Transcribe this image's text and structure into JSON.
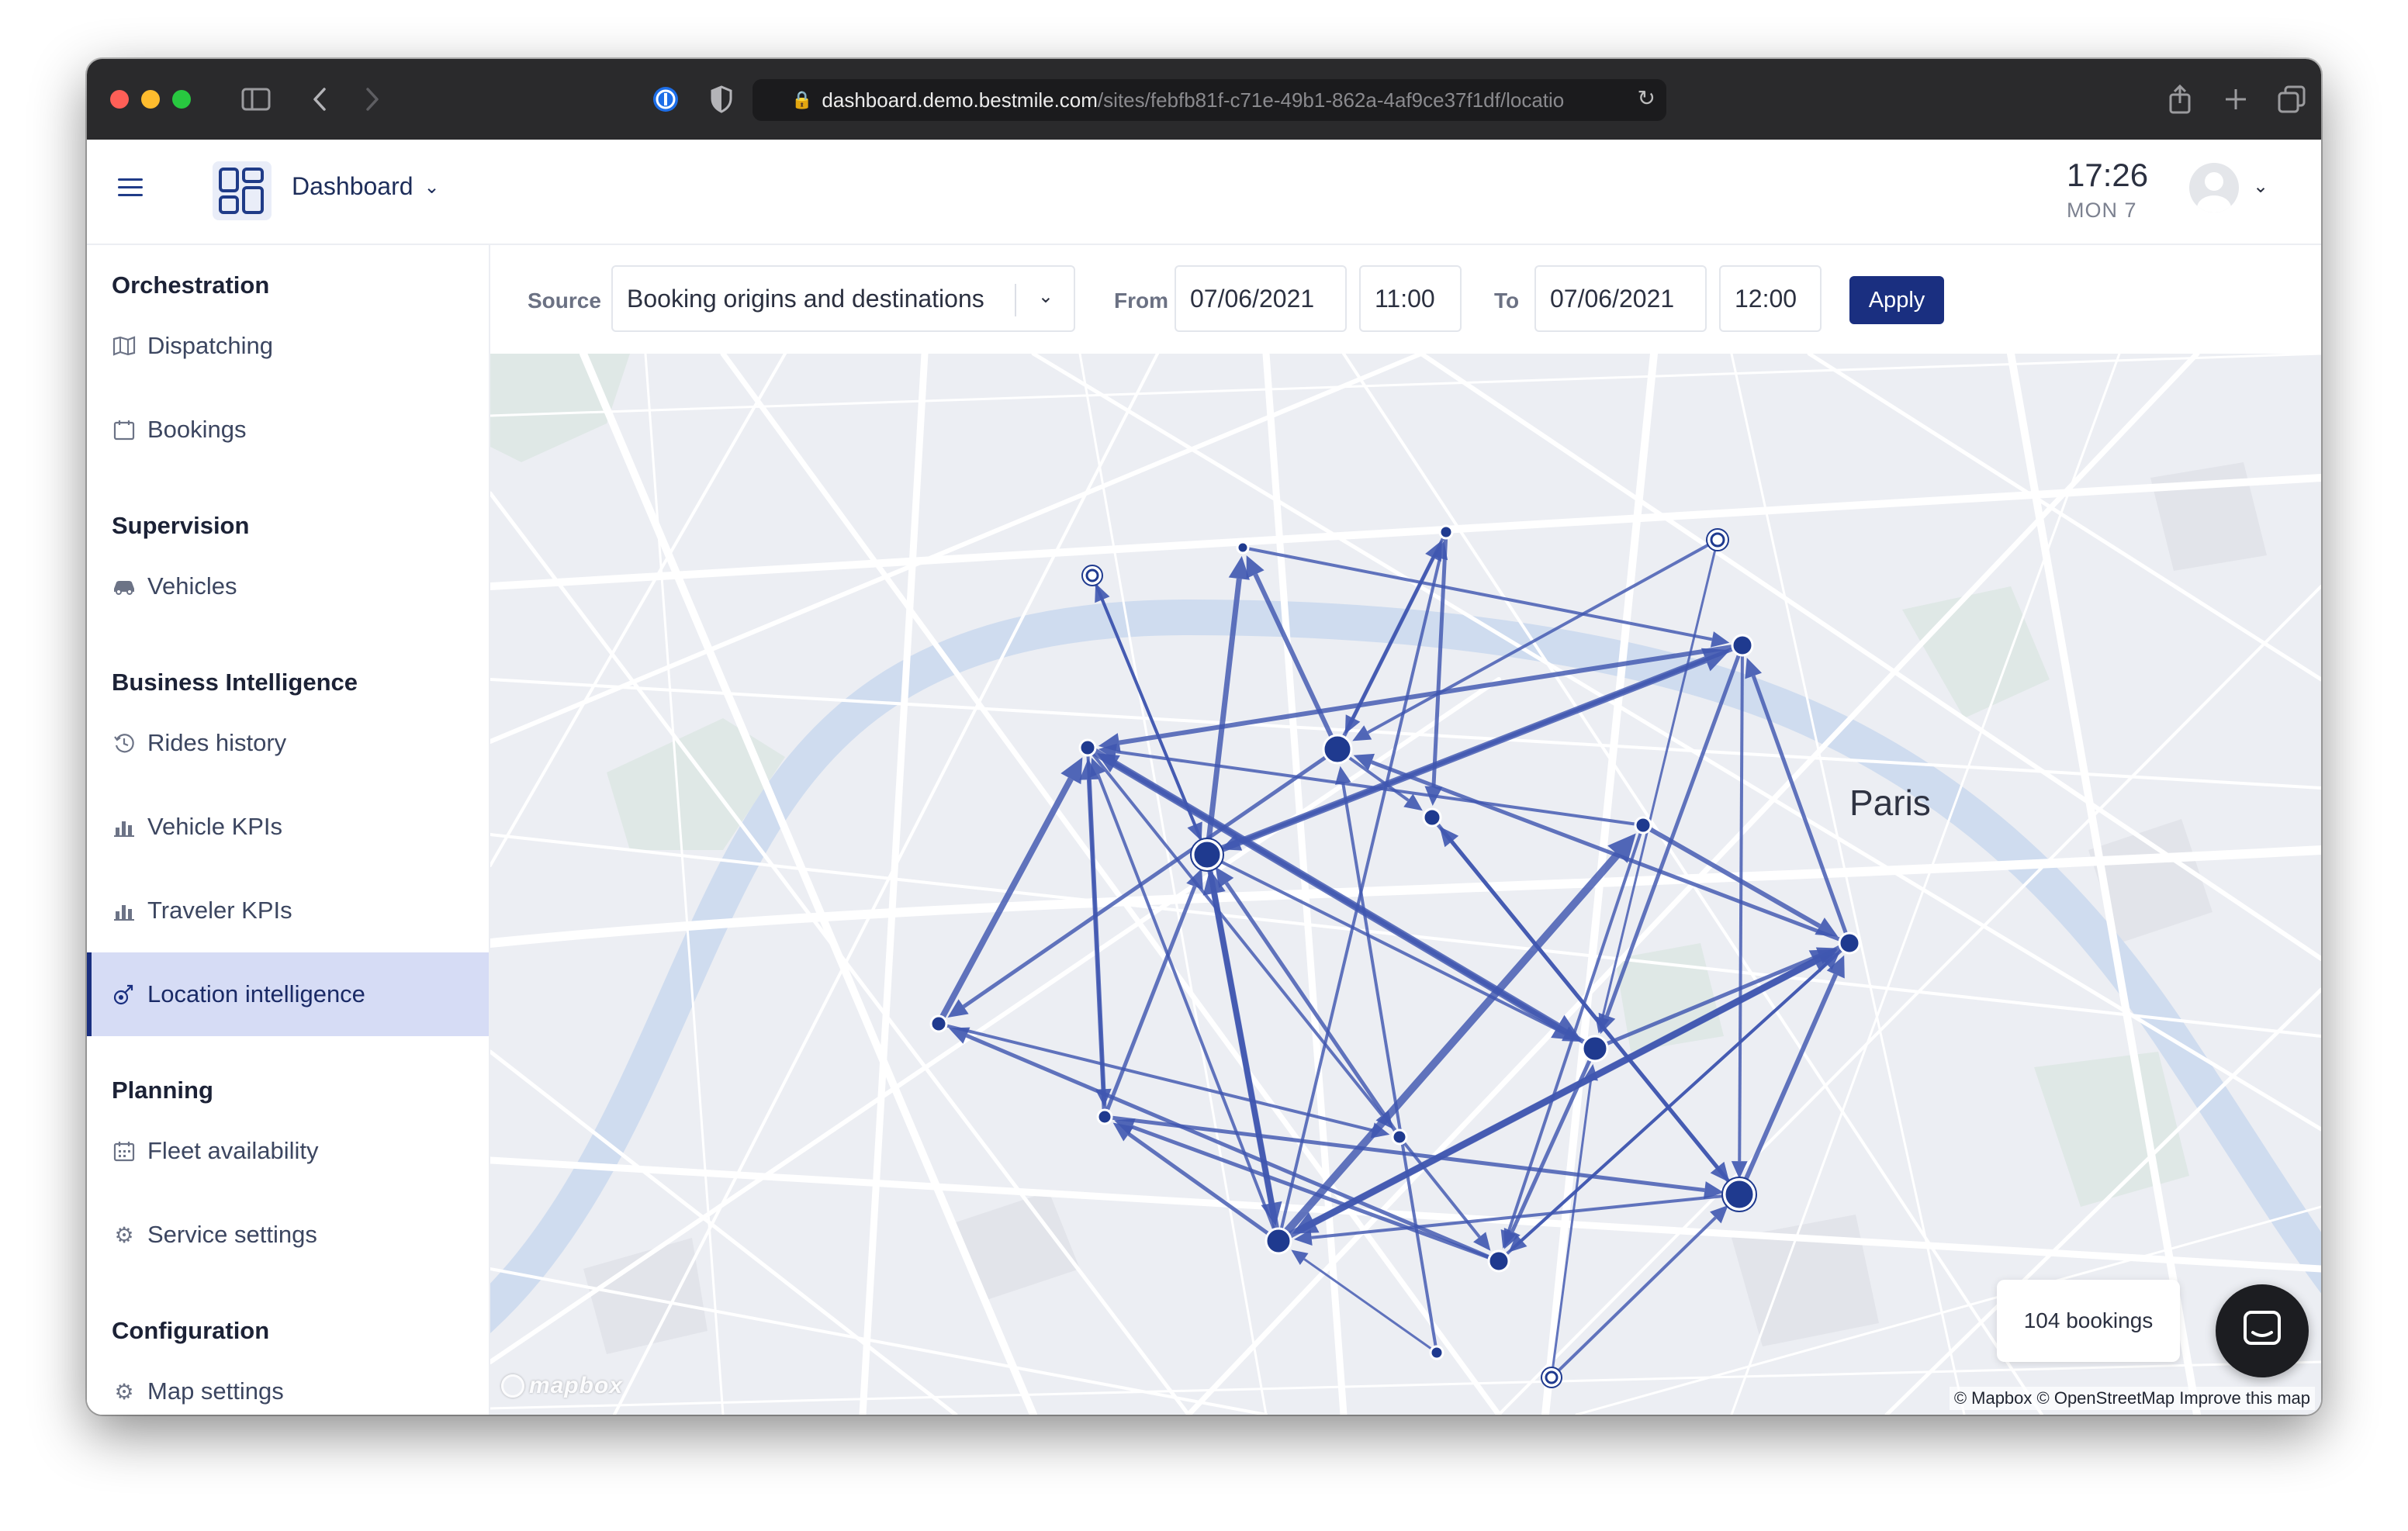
{
  "browser": {
    "url_host": "dashboard.demo.bestmile.com",
    "url_path": "/sites/febfb81f-c71e-49b1-862a-4af9ce37f1df/locatio"
  },
  "header": {
    "app_name": "Dashboard",
    "time": "17:26",
    "date": "MON 7"
  },
  "sidebar": {
    "sections": [
      {
        "title": "Orchestration",
        "items": [
          {
            "label": "Dispatching",
            "icon": "map-icon"
          },
          {
            "label": "Bookings",
            "icon": "calendar-icon"
          }
        ]
      },
      {
        "title": "Supervision",
        "items": [
          {
            "label": "Vehicles",
            "icon": "car-icon"
          }
        ]
      },
      {
        "title": "Business Intelligence",
        "items": [
          {
            "label": "Rides history",
            "icon": "history-icon"
          },
          {
            "label": "Vehicle KPIs",
            "icon": "bar-chart-icon"
          },
          {
            "label": "Traveler KPIs",
            "icon": "bar-chart-icon"
          },
          {
            "label": "Location intelligence",
            "icon": "location-icon",
            "active": true
          }
        ]
      },
      {
        "title": "Planning",
        "items": [
          {
            "label": "Fleet availability",
            "icon": "calendar-grid-icon"
          },
          {
            "label": "Service settings",
            "icon": "gear-icon"
          }
        ]
      },
      {
        "title": "Configuration",
        "items": [
          {
            "label": "Map settings",
            "icon": "gear-icon"
          }
        ]
      }
    ]
  },
  "filters": {
    "source_label": "Source",
    "source_value": "Booking origins and destinations",
    "from_label": "From",
    "from_date": "07/06/2021",
    "from_time": "11:00",
    "to_label": "To",
    "to_date": "07/06/2021",
    "to_time": "12:00",
    "apply_label": "Apply"
  },
  "map": {
    "city_label": "Paris",
    "bookings_count": "104 bookings",
    "mapbox_logo": "mapbox",
    "attribution": "© Mapbox © OpenStreetMap Improve this map",
    "flow_color": "#3f57b0",
    "node_color": "#1f3a8f"
  }
}
